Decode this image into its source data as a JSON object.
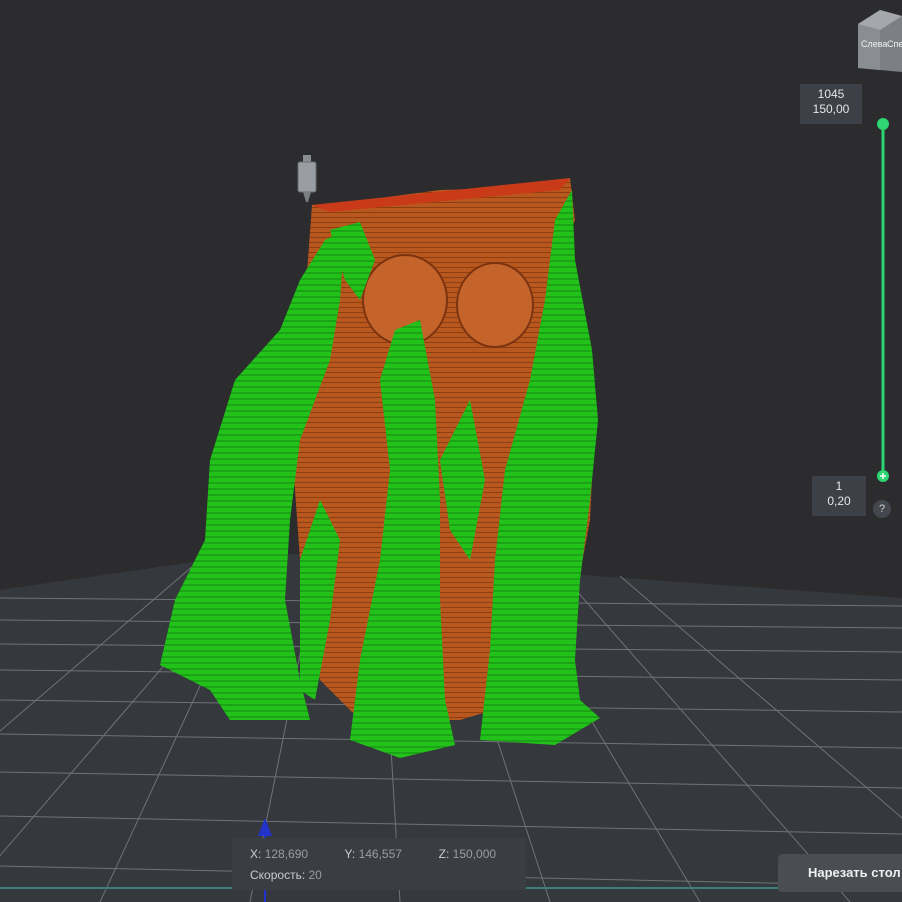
{
  "view_cube": {
    "face_label": "Слева",
    "side_label": "Спе"
  },
  "layer_slider": {
    "top": {
      "layer": "1045",
      "height": "150,00"
    },
    "bottom": {
      "layer": "1",
      "height": "0,20"
    },
    "help": "?"
  },
  "position_info": {
    "x_label": "X:",
    "x_value": "128,690",
    "y_label": "Y:",
    "y_value": "146,557",
    "z_label": "Z:",
    "z_value": "150,000",
    "speed_label": "Скорость:",
    "speed_value": "20"
  },
  "slice_button": {
    "label": "Нарезать стол"
  },
  "colors": {
    "background": "#2c2c2f",
    "support": "#22c21a",
    "model": "#b8581f",
    "slider": "#2ed573",
    "panel": "#3a3d42"
  }
}
